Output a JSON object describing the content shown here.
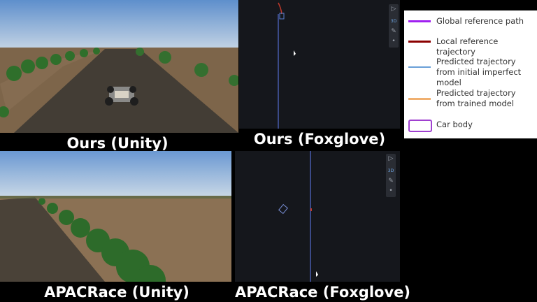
{
  "captions": {
    "ours_unity": "Ours (Unity)",
    "ours_foxglove": "Ours (Foxglove)",
    "apacrace_unity": "APACRace (Unity)",
    "apacrace_foxglove": "APACRace (Foxglove)"
  },
  "legend": {
    "items": [
      {
        "label": "Global reference path",
        "color": "#a020f0",
        "kind": "line"
      },
      {
        "label": "Local reference trajectory",
        "color": "#8b0000",
        "kind": "line"
      },
      {
        "label": "Predicted trajectory from initial imperfect model",
        "color": "#6aa0d8",
        "kind": "line"
      },
      {
        "label": "Predicted trajectory from trained model",
        "color": "#f0b070",
        "kind": "line"
      },
      {
        "label": "Car body",
        "color": "#a040d0",
        "kind": "box"
      }
    ]
  },
  "foxglove_toolbar": {
    "icons": [
      "select-icon",
      "3d-icon",
      "ruler-icon",
      "dot-icon"
    ],
    "glyphs": [
      "▷",
      "3D",
      "✎",
      "•"
    ]
  },
  "colors": {
    "sky_top": "#6f9bd0",
    "sky_bottom": "#b9cde0",
    "soil": "#7a6248",
    "road": "#3e3a34",
    "plant": "#2f6b2a",
    "foxglove_bg": "#15171c",
    "path": "#3a4a8a"
  }
}
